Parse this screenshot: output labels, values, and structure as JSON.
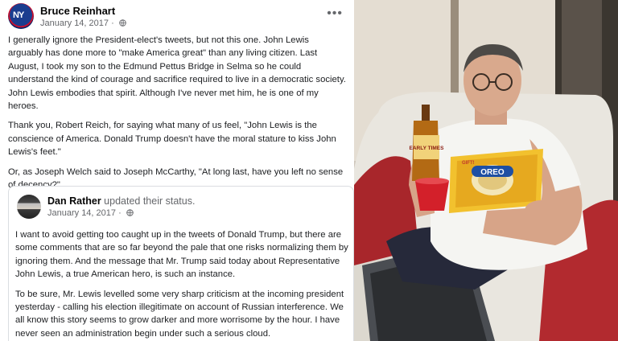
{
  "post": {
    "author": "Bruce Reinhart",
    "date": "January 14, 2017",
    "avatar_text": "NY",
    "paragraphs": [
      "I generally ignore the President-elect's tweets, but not this one. John Lewis arguably has done more to \"make America great\" than any living citizen. Last August, I took my son to the Edmund Pettus Bridge in Selma so he could understand the kind of courage and sacrifice required to live in a democratic society.  John Lewis embodies that spirit. Although I've never met him, he is one of my heroes.",
      "Thank you, Robert Reich, for saying what many of us feel, \"John Lewis is the conscience of America. Donald Trump doesn't have the moral stature to kiss John Lewis's feet.\"",
      "Or, as Joseph Welch said to Joseph McCarthy, \"At long last, have you left no sense of decency?\""
    ]
  },
  "shared": {
    "author": "Dan Rather",
    "action": "updated their status.",
    "date": "January 14, 2017",
    "paragraphs": [
      "I want to avoid getting too caught up in the tweets of Donald Trump, but there are some comments that are so far beyond the pale that one risks normalizing them by ignoring them. And the message that Mr. Trump said today about Representative John Lewis, a true American hero, is such an instance.",
      "To be sure, Mr. Lewis levelled some very sharp criticism at the incoming president yesterday - calling his election illegitimate on account of Russian interference. We all know this story seems to grow darker and more worrisome by the hour. I have never seen an administration begin under such a serious cloud."
    ]
  },
  "photo": {
    "bottle_label": "EARLY TIMES",
    "cookie_brand": "OREO",
    "cookie_flag": "GIFT!"
  },
  "icons": {
    "globe": "globe-icon",
    "more": "more-options-icon"
  },
  "colors": {
    "text": "#1c1e21",
    "secondary": "#65676b",
    "border": "#dadde1",
    "oreo_blue": "#1e4fa3",
    "package_yellow": "#f2c12e"
  }
}
